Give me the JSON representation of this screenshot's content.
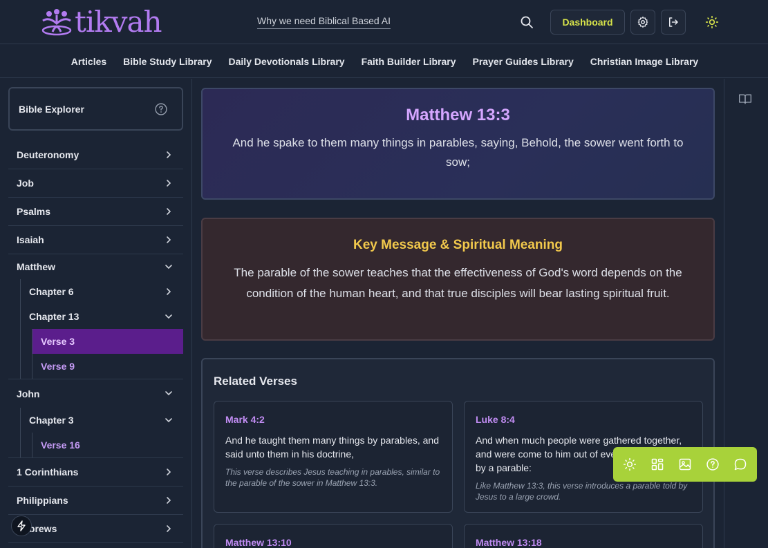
{
  "header": {
    "logo_text": "tikvah",
    "search_link": "Why we need Biblical Based AI",
    "dashboard_label": "Dashboard"
  },
  "nav": {
    "items": [
      {
        "label": "Articles"
      },
      {
        "label": "Bible Study Library"
      },
      {
        "label": "Daily Devotionals Library"
      },
      {
        "label": "Faith Builder Library"
      },
      {
        "label": "Prayer Guides Library"
      },
      {
        "label": "Christian Image Library"
      }
    ]
  },
  "sidebar": {
    "title": "Bible Explorer",
    "books": {
      "deuteronomy": "Deuteronomy",
      "job": "Job",
      "psalms": "Psalms",
      "isaiah": "Isaiah",
      "matthew": "Matthew",
      "john": "John",
      "corinthians": "1 Corinthians",
      "philippians": "Philippians",
      "hebrews": "Hebrews"
    },
    "matthew_chapters": {
      "ch6": "Chapter 6",
      "ch13": "Chapter 13",
      "ch13_verses": [
        "Verse 3",
        "Verse 9"
      ]
    },
    "john_chapters": {
      "ch3": "Chapter 3",
      "ch3_verses": [
        "Verse 16"
      ]
    }
  },
  "main": {
    "verse_ref": "Matthew 13:3",
    "verse_text": "And he spake to them many things in parables, saying, Behold, the sower went forth to sow;",
    "meaning_title": "Key Message & Spiritual Meaning",
    "meaning_text": "The parable of the sower teaches that the effectiveness of God's word depends on the condition of the human heart, and that true disciples will bear lasting spiritual fruit.",
    "related_title": "Related Verses",
    "related": [
      {
        "ref": "Mark 4:2",
        "text": "And he taught them many things by parables, and said unto them in his doctrine,",
        "note": "This verse describes Jesus teaching in parables, similar to the parable of the sower in Matthew 13:3."
      },
      {
        "ref": "Luke 8:4",
        "text": "And when much people were gathered together, and were come to him out of every city, he spake by a parable:",
        "note": "Like Matthew 13:3, this verse introduces a parable told by Jesus to a large crowd."
      },
      {
        "ref": "Matthew 13:10"
      },
      {
        "ref": "Matthew 13:18"
      }
    ]
  },
  "colors": {
    "accent_purple": "#b27bf0",
    "active_verse_bg": "#5b1e8c",
    "dashboard_text": "#d7e34a",
    "meaning_title": "#f2c94c",
    "float_toolbar": "#a8d23a"
  },
  "icons": {
    "floating_toolbar": [
      "sun-icon",
      "apps-grid-icon",
      "image-icon",
      "help-circle-icon",
      "chat-bubble-icon"
    ]
  }
}
